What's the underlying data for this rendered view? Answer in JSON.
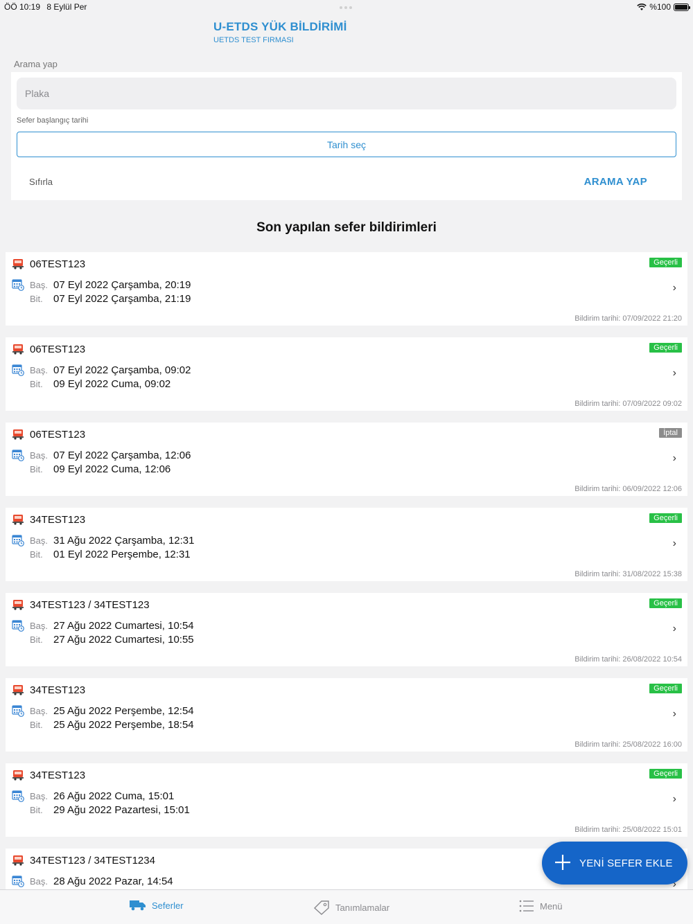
{
  "status_bar": {
    "time": "ÖÖ 10:19",
    "date": "8 Eylül Per",
    "battery": "%100"
  },
  "app": {
    "title": "U-ETDS YÜK BİLDİRİMİ",
    "subtitle": "UETDS TEST FIRMASI"
  },
  "search": {
    "section_label": "Arama yap",
    "plate_placeholder": "Plaka",
    "date_label": "Sefer başlangıç tarihi",
    "date_button": "Tarih seç",
    "reset_label": "Sıfırla",
    "search_label": "ARAMA YAP"
  },
  "list": {
    "title": "Son yapılan sefer bildirimleri",
    "start_label": "Baş.",
    "end_label": "Bit.",
    "items": [
      {
        "plate": "06TEST123",
        "status": "Geçerli",
        "status_kind": "valid",
        "start": "07 Eyl 2022 Çarşamba, 20:19",
        "end": "07 Eyl 2022 Çarşamba, 21:19",
        "notified": "Bildirim tarihi: 07/09/2022 21:20"
      },
      {
        "plate": "06TEST123",
        "status": "Geçerli",
        "status_kind": "valid",
        "start": "07 Eyl 2022 Çarşamba, 09:02",
        "end": "09 Eyl 2022 Cuma, 09:02",
        "notified": "Bildirim tarihi: 07/09/2022 09:02"
      },
      {
        "plate": "06TEST123",
        "status": "İptal",
        "status_kind": "cancel",
        "start": "07 Eyl 2022 Çarşamba, 12:06",
        "end": "09 Eyl 2022 Cuma, 12:06",
        "notified": "Bildirim tarihi: 06/09/2022 12:06"
      },
      {
        "plate": "34TEST123",
        "status": "Geçerli",
        "status_kind": "valid",
        "start": "31 Ağu 2022 Çarşamba, 12:31",
        "end": "01 Eyl 2022 Perşembe, 12:31",
        "notified": "Bildirim tarihi: 31/08/2022 15:38"
      },
      {
        "plate": "34TEST123 / 34TEST123",
        "status": "Geçerli",
        "status_kind": "valid",
        "start": "27 Ağu 2022 Cumartesi, 10:54",
        "end": "27 Ağu 2022 Cumartesi, 10:55",
        "notified": "Bildirim tarihi: 26/08/2022 10:54"
      },
      {
        "plate": "34TEST123",
        "status": "Geçerli",
        "status_kind": "valid",
        "start": "25 Ağu 2022 Perşembe, 12:54",
        "end": "25 Ağu 2022 Perşembe, 18:54",
        "notified": "Bildirim tarihi: 25/08/2022 16:00"
      },
      {
        "plate": "34TEST123",
        "status": "Geçerli",
        "status_kind": "valid",
        "start": "26 Ağu 2022 Cuma, 15:01",
        "end": "29 Ağu 2022 Pazartesi, 15:01",
        "notified": "Bildirim tarihi: 25/08/2022 15:01"
      },
      {
        "plate": "34TEST123 / 34TEST1234",
        "status": "",
        "status_kind": "valid",
        "start": "28 Ağu 2022 Pazar, 14:54",
        "end": "",
        "notified": ""
      }
    ]
  },
  "fab": {
    "label": "YENİ SEFER EKLE",
    "color": "#1565c8"
  },
  "tabs": [
    {
      "label": "Seferler",
      "icon": "truck-icon",
      "active": true
    },
    {
      "label": "Tanımlamalar",
      "icon": "tag-icon",
      "active": false
    },
    {
      "label": "Menü",
      "icon": "list-icon",
      "active": false
    }
  ],
  "colors": {
    "accent": "#2f8fd0",
    "valid": "#28c046",
    "cancel": "#8c8c8c"
  }
}
